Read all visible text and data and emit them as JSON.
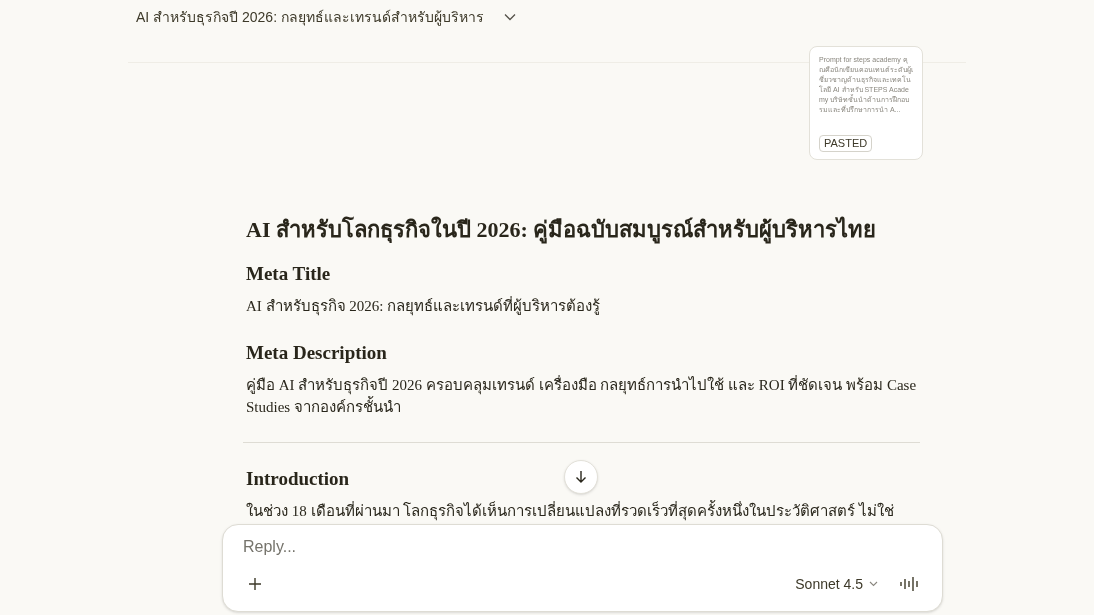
{
  "header": {
    "title": "AI สำหรับธุรกิจปี 2026: กลยุทธ์และเทรนด์สำหรับผู้บริหาร"
  },
  "pasted_card": {
    "preview": "Prompt for steps academy คุณคือนักเขียนคอนเทนต์ระดับผู้เชี่ยวชาญด้านธุรกิจและเทคโนโลยี AI สำหรับ STEPS Academy บริษัทชั้นนำด้านการฝึกอบรมและที่ปรึกษาการนำ A...",
    "badge": "PASTED"
  },
  "article": [
    {
      "kind": "title",
      "text": "AI สำหรับโลกธุรกิจในปี 2026: คู่มือฉบับสมบูรณ์สำหรับผู้บริหารไทย"
    },
    {
      "kind": "heading",
      "text": "Meta Title"
    },
    {
      "kind": "paragraph",
      "text": "AI สำหรับธุรกิจ 2026: กลยุทธ์และเทรนด์ที่ผู้บริหารต้องรู้"
    },
    {
      "kind": "heading",
      "text": "Meta Description"
    },
    {
      "kind": "paragraph",
      "text": "คู่มือ AI สำหรับธุรกิจปี 2026 ครอบคลุมเทรนด์ เครื่องมือ กลยุทธ์การนำไปใช้ และ ROI ที่ชัดเจน พร้อม Case Studies จากองค์กรชั้นนำ"
    },
    {
      "kind": "rule"
    },
    {
      "kind": "heading",
      "text": "Introduction"
    },
    {
      "kind": "paragraph",
      "text": "ในช่วง 18 เดือนที่ผ่านมา โลกธุรกิจได้เห็นการเปลี่ยนแปลงที่รวดเร็วที่สุดครั้งหนึ่งในประวัติศาสตร์ ไม่ใช่"
    }
  ],
  "composer": {
    "placeholder": "Reply...",
    "model": "Sonnet 4.5"
  }
}
